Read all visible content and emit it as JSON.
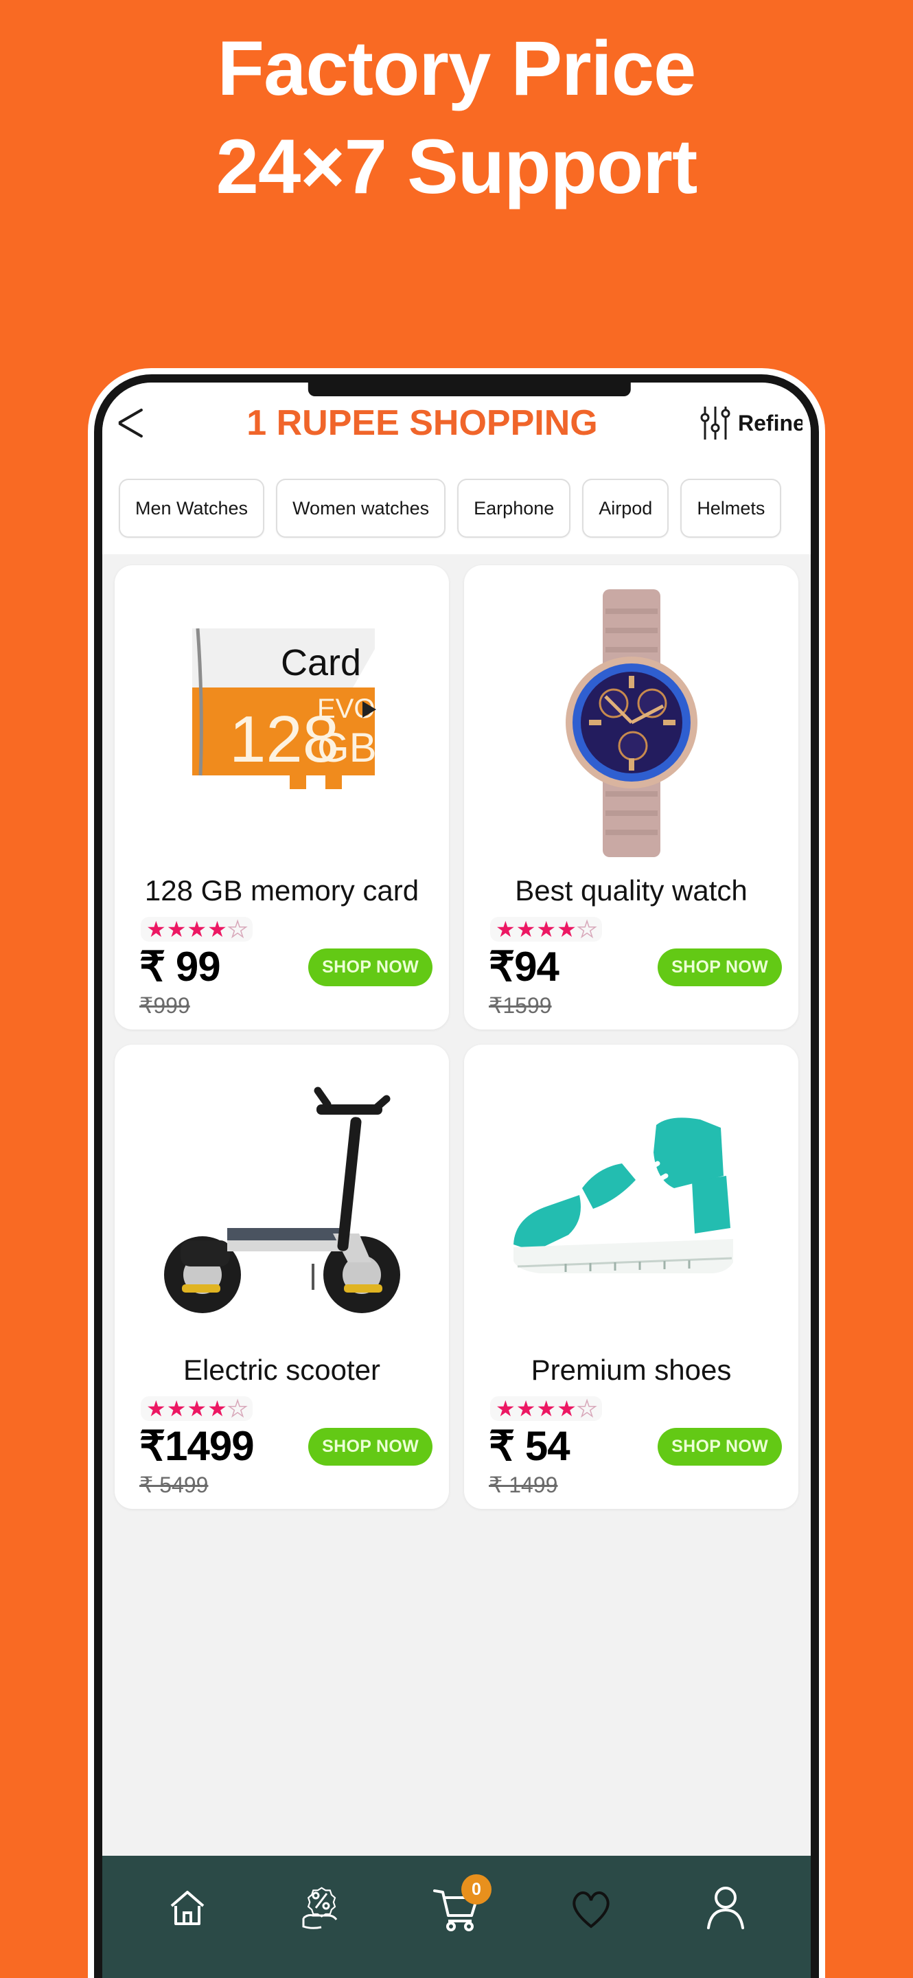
{
  "promo": {
    "line1": "Factory Price",
    "line2": "24×7 Support",
    "background_color": "#f96a23",
    "text_color": "#ffffff"
  },
  "app": {
    "title": "1 RUPEE SHOPPING",
    "title_color": "#f0652a",
    "back_icon": "back-arrow-icon",
    "refine_label": "Refine",
    "refine_icon": "sliders-filter-icon"
  },
  "categories": [
    {
      "label": "Men Watches"
    },
    {
      "label": "Women watches"
    },
    {
      "label": "Earphone"
    },
    {
      "label": "Airpod"
    },
    {
      "label": "Helmets"
    }
  ],
  "products": [
    {
      "title": "128 GB memory card",
      "price": "₹ 99",
      "old_price": "₹999",
      "rating": 4,
      "rating_max": 5,
      "cta": "SHOP NOW",
      "image": "memory-card-image",
      "image_texts": {
        "top": "Card",
        "capacity": "128",
        "unit": "GB",
        "series": "EVO"
      }
    },
    {
      "title": "Best quality watch",
      "price": "₹94",
      "old_price": "₹1599",
      "rating": 4,
      "rating_max": 5,
      "cta": "SHOP NOW",
      "image": "wristwatch-image"
    },
    {
      "title": "Electric scooter",
      "price": "₹1499",
      "old_price": "₹ 5499",
      "rating": 4,
      "rating_max": 5,
      "cta": "SHOP NOW",
      "image": "electric-scooter-image"
    },
    {
      "title": "Premium shoes",
      "price": "₹ 54",
      "old_price": "₹ 1499",
      "rating": 4,
      "rating_max": 5,
      "cta": "SHOP NOW",
      "image": "sneaker-image"
    }
  ],
  "bottom_nav": {
    "background_color": "#2b4a47",
    "items": [
      {
        "icon": "home-icon"
      },
      {
        "icon": "offers-percent-hand-icon"
      },
      {
        "icon": "shopping-cart-icon",
        "badge": "0",
        "badge_color": "#e8901d"
      },
      {
        "icon": "heart-wishlist-icon"
      },
      {
        "icon": "user-profile-icon"
      }
    ]
  },
  "colors": {
    "accent_orange": "#f96a23",
    "brand_orange": "#f0652a",
    "cta_green": "#63c915",
    "star_pink": "#ec1863",
    "nav_teal": "#2b4a47"
  }
}
